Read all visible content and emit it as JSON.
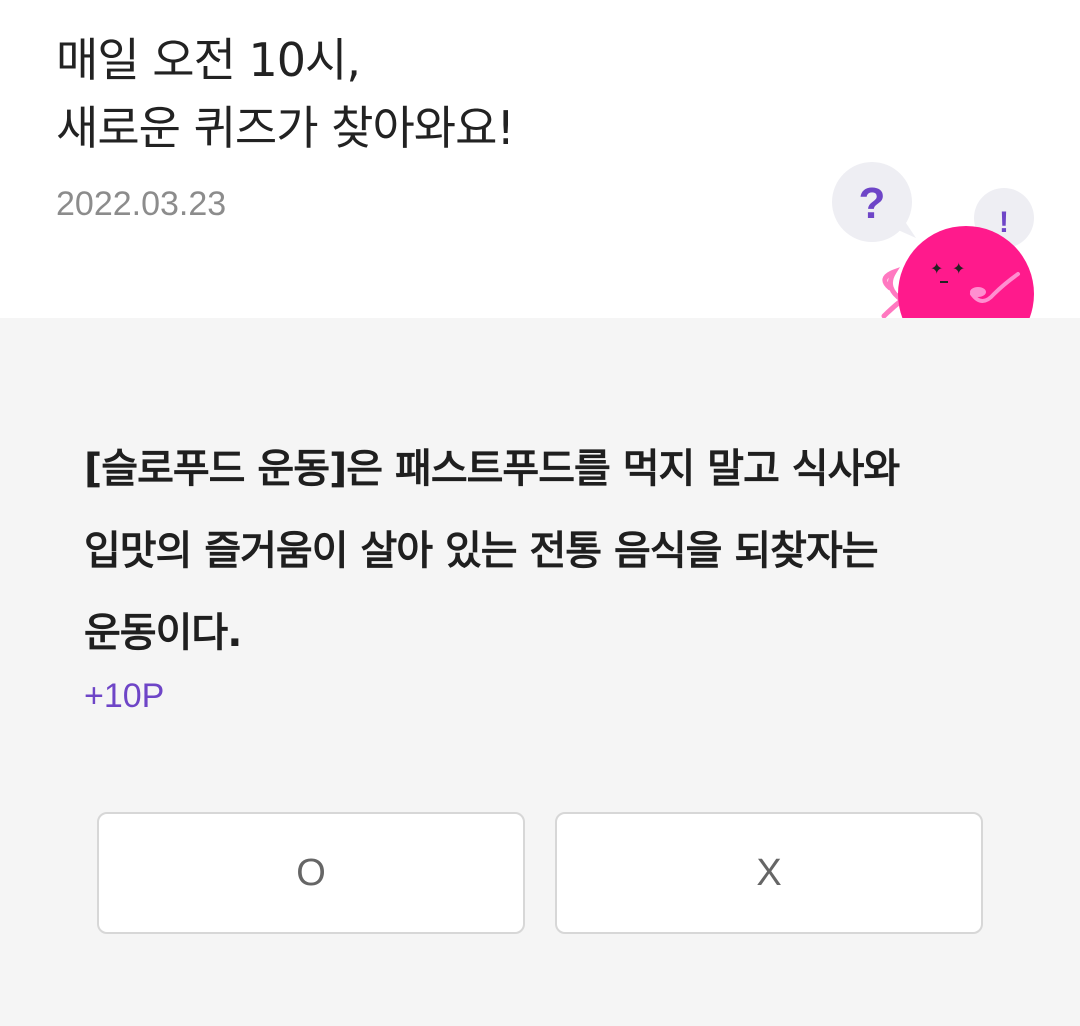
{
  "header": {
    "headline_line1": "매일 오전 10시,",
    "headline_line2": "새로운 퀴즈가 찾아와요!",
    "date": "2022.03.23"
  },
  "mascot": {
    "question_mark": "?",
    "exclamation_mark": "!",
    "body_color": "#ff1a8c",
    "accent_color": "#6e45c7"
  },
  "quiz": {
    "question": "[슬로푸드 운동]은 패스트푸드를 먹지 말고 식사와 입맛의 즐거움이 살아 있는 전통 음식을 되찾자는 운동이다.",
    "points": "+10P",
    "answers": {
      "o_label": "O",
      "x_label": "X"
    }
  }
}
